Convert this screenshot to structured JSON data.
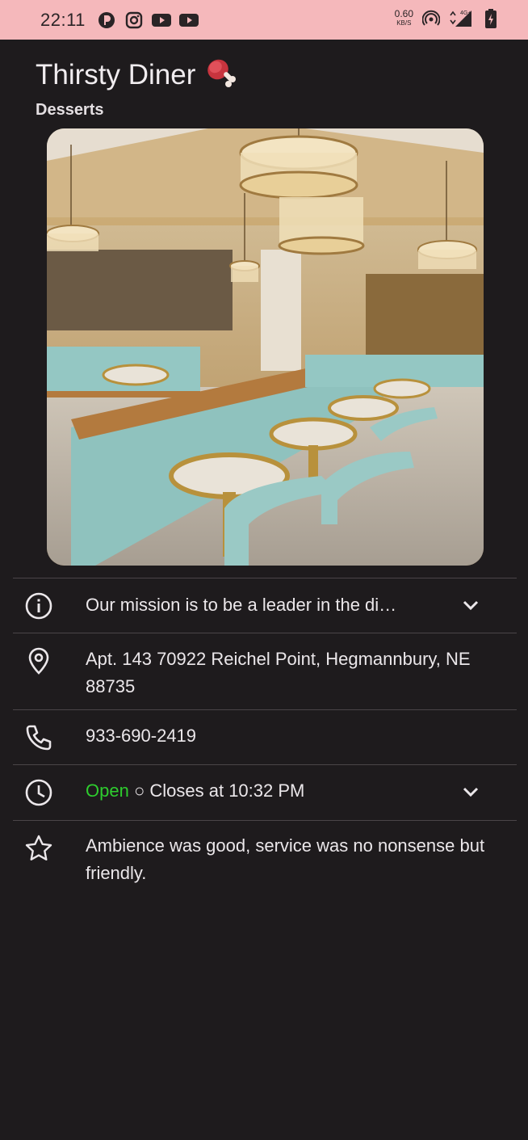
{
  "status_bar": {
    "time": "22:11",
    "net_speed_value": "0.60",
    "net_speed_unit": "KB/S",
    "network": "4G+",
    "background_color": "#f5b8bb"
  },
  "restaurant": {
    "name": "Thirsty Diner",
    "name_emoji": "🍖",
    "category": "Desserts",
    "photo_icon": "restaurant-interior-photo"
  },
  "details": {
    "description": "Our mission is to be a leader in the di…",
    "address": "Apt. 143 70922 Reichel Point, Hegmannbury, NE 88735",
    "phone": "933-690-2419",
    "hours_status": "Open",
    "hours_separator": "○",
    "hours_text": "Closes at 10:32 PM",
    "review": "Ambience was good, service was no nonsense but friendly.",
    "open_color": "#2ecc2e"
  },
  "icons": {
    "info": "info-icon",
    "location": "location-pin-icon",
    "phone": "phone-icon",
    "clock": "clock-icon",
    "star": "star-icon",
    "expand": "chevron-down-icon"
  }
}
